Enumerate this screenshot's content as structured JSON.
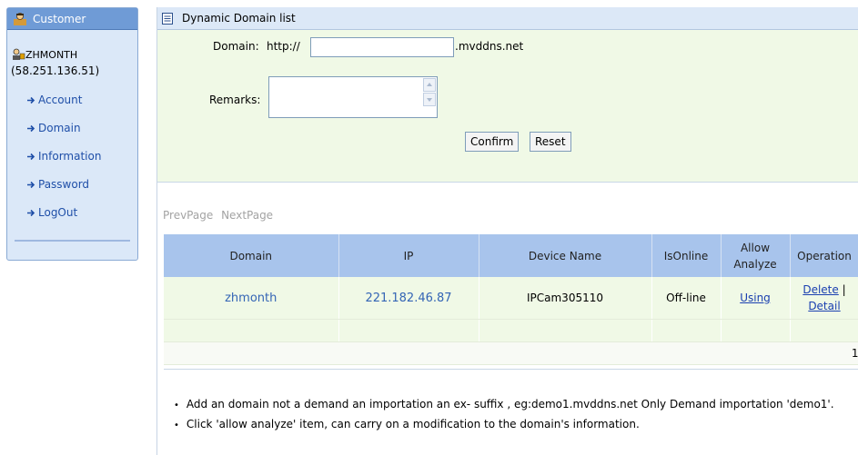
{
  "sidebar": {
    "title": "Customer",
    "username": "ZHMONTH",
    "user_ip": "(58.251.136.51)",
    "items": [
      {
        "label": "Account"
      },
      {
        "label": "Domain"
      },
      {
        "label": "Information"
      },
      {
        "label": "Password"
      },
      {
        "label": "LogOut"
      }
    ]
  },
  "main": {
    "title": "Dynamic Domain list",
    "form": {
      "domain_label": "Domain:",
      "domain_prefix": "http://",
      "domain_value": "",
      "domain_suffix": ".mvddns.net",
      "remarks_label": "Remarks:",
      "remarks_value": "",
      "confirm_label": "Confirm",
      "reset_label": "Reset"
    },
    "pager": {
      "prev": "PrevPage",
      "next": "NextPage"
    },
    "table": {
      "headers": [
        "Domain",
        "IP",
        "Device Name",
        "IsOnline",
        "Allow Analyze",
        "Operation"
      ],
      "rows": [
        {
          "domain": "zhmonth",
          "ip": "221.182.46.87",
          "device_name": "IPCam305110",
          "is_online": "Off-line",
          "allow_analyze": "Using",
          "op_delete": "Delete",
          "op_sep": "|",
          "op_detail": "Detail"
        }
      ],
      "footer_page": "1"
    },
    "notes": [
      "Add an domain not a demand an importation an ex- suffix , eg:demo1.mvddns.net Only Demand importation 'demo1'.",
      "Click 'allow analyze' item, can carry on a modification to the domain's information."
    ]
  },
  "colors": {
    "sidebar_bg": "#dbe8f8",
    "sidebar_header": "#6f9bd6",
    "form_bg": "#f0f9e6",
    "table_header": "#a8c4ec",
    "link_blue": "#3465b5"
  }
}
